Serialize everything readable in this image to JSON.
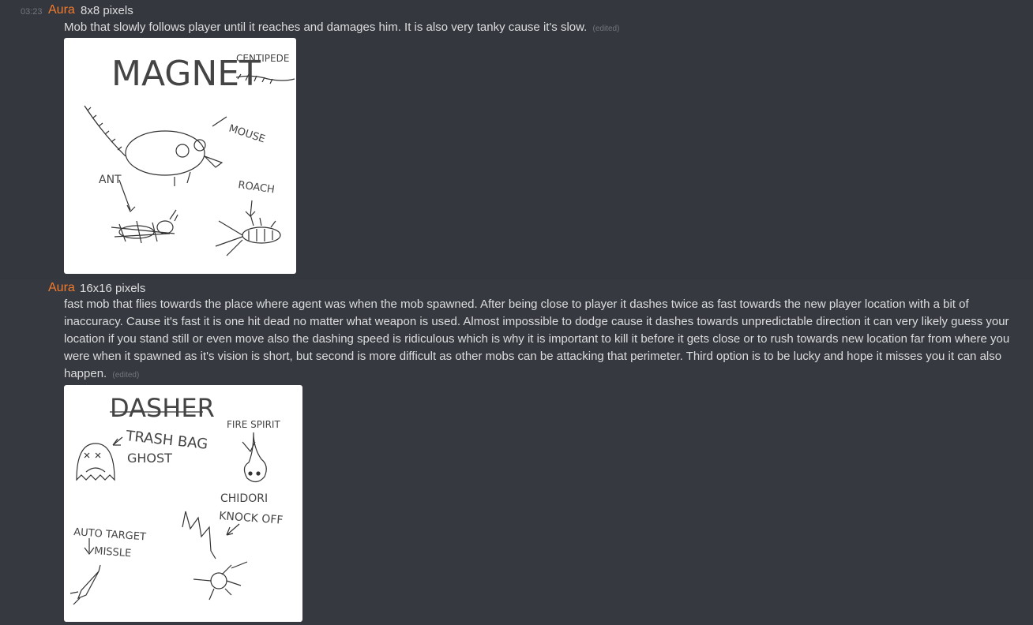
{
  "messages": [
    {
      "timestamp": "03:23",
      "author": "Aura",
      "title": "8x8 pixels",
      "body": "Mob that slowly follows player until it reaches and damages him. It is also very tanky cause it's slow.",
      "edited": "(edited)",
      "image_labels": [
        "MAGNET",
        "CENTIPEDE",
        "MOUSE",
        "ANT",
        "ROACH"
      ]
    },
    {
      "author": "Aura",
      "title": "16x16 pixels",
      "body": "fast mob that flies towards the place where agent was when the mob spawned. After being close to player it dashes twice as fast towards the new player location with a bit of inaccuracy. Cause it's fast it is one hit dead no matter what weapon is used. Almost impossible to dodge cause it dashes towards unpredictable direction it can very likely guess your location if you stand still or even move also the dashing speed is ridiculous which is why it is important to kill it before it gets close or to rush towards new location far from where you were when it spawned as it's vision is short, but second is more difficult as other mobs can be attacking that perimeter. Third option is to be lucky and hope it misses you it can also happen.",
      "edited": "(edited)",
      "image_labels": [
        "DASHER",
        "FIRE SPIRIT",
        "TRASH BAG",
        "GHOST",
        "CHIDORI",
        "KNOCK OFF",
        "AUTO TARGET",
        "MISSLE"
      ]
    }
  ]
}
